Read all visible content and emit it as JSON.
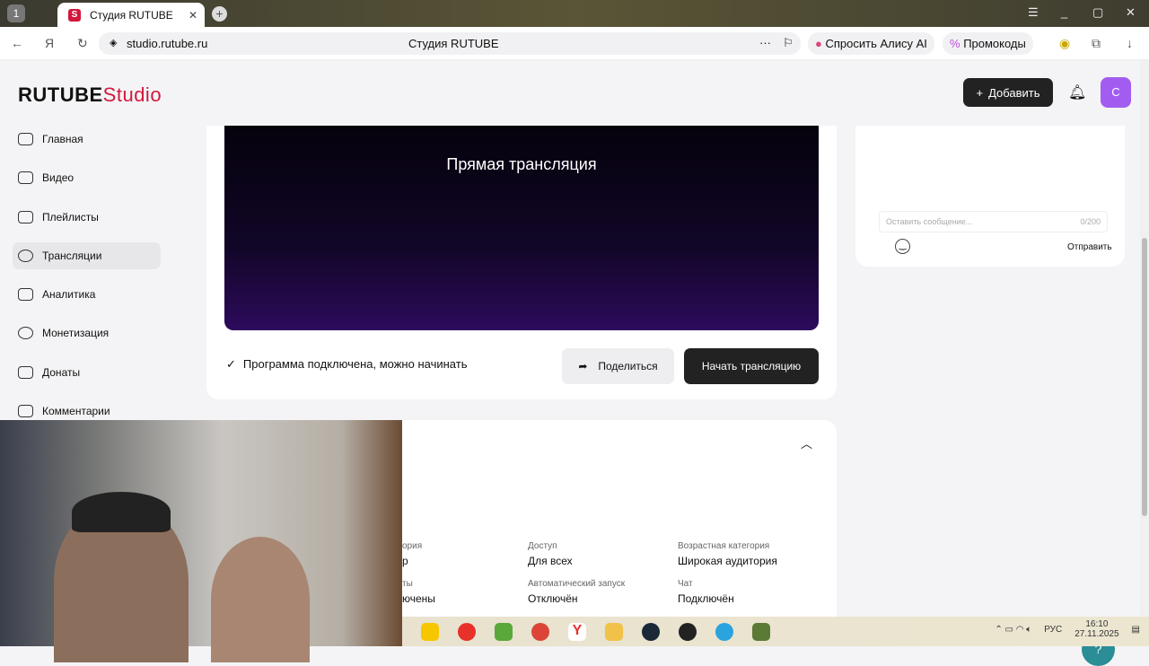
{
  "browser": {
    "tab_count": "1",
    "tab_title": "Студия RUTUBE",
    "url": "studio.rutube.ru",
    "page_title": "Студия RUTUBE",
    "alice": "Спросить Алису AI",
    "promo": "Промокоды"
  },
  "header": {
    "logo_main": "RUTUBE",
    "logo_sub": "Studio",
    "add_label": "Добавить",
    "avatar": "С"
  },
  "sidebar": {
    "items": [
      {
        "label": "Главная"
      },
      {
        "label": "Видео"
      },
      {
        "label": "Плейлисты"
      },
      {
        "label": "Трансляции"
      },
      {
        "label": "Аналитика"
      },
      {
        "label": "Монетизация"
      },
      {
        "label": "Донаты"
      },
      {
        "label": "Комментарии"
      }
    ]
  },
  "stream": {
    "player_title": "Прямая трансляция",
    "status": "Программа подключена, можно начинать",
    "share": "Поделиться",
    "start": "Начать трансляцию"
  },
  "chat": {
    "placeholder": "Оставить сообщение...",
    "counter": "0/200",
    "send": "Отправить"
  },
  "details": {
    "cat_label": "ория",
    "cat_value": "р",
    "comments_label": "ты",
    "comments_value": "ючены",
    "access_label": "Доступ",
    "access_value": "Для всех",
    "age_label": "Возрастная категория",
    "age_value": "Широкая аудитория",
    "auto_label": "Автоматический запуск",
    "auto_value": "Отключён",
    "chat_label": "Чат",
    "chat_value": "Подключён"
  },
  "tray": {
    "lang": "РУС",
    "time": "16:10",
    "date": "27.11.2025"
  }
}
